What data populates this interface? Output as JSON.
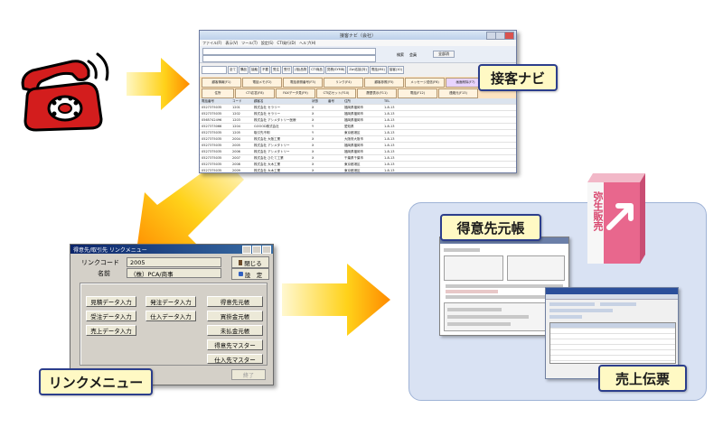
{
  "callouts": {
    "navi": "接客ナビ",
    "ledger": "得意先元帳",
    "link_menu": "リンクメニュー",
    "sales_slip": "売上伝票"
  },
  "product_box": {
    "label": "弥生販売"
  },
  "navi_window": {
    "title": "接客ナビ（会社）",
    "menu": [
      "ファイル(F)",
      "表示(V)",
      "ツール(T)",
      "設定(S)",
      "CTI発行(D)",
      "ヘルプ(H)"
    ],
    "options": [
      "検索",
      "会員"
    ],
    "search_button": "全部消",
    "tabs": [
      "全て",
      "購品",
      "接触",
      "不要",
      "受注",
      "受付",
      "(相)品物",
      "CTI商品",
      "見積(SYMB)",
      "Zwi応接(対)",
      "電話(M4)",
      "接客(10)"
    ],
    "buttons": [
      "顧客情報(F1)",
      "電話メモ(F2)",
      "電話参照番号(F3)",
      "リンク(F4)",
      "顧客参照(F5)",
      "メッセージ送信(F6)",
      "画面削除(F7)",
      "住所",
      "CTI応答(F8)",
      "FAXデータ見(F9)",
      "CTI応セット(F10)",
      "履歴表示(F11)",
      "電話(F12)",
      "連絡元(F13)",
      "画面ライン(F14)",
      "メッセージ",
      "アラーム"
    ],
    "grid_header": [
      "電話番号",
      "コード",
      "顧客名",
      "状態",
      "番号",
      "住所",
      "TEL"
    ],
    "grid_rows": [
      [
        "0527375035",
        "1201",
        "株式会社 セラリー",
        "X",
        "福岡県福岡市",
        "1-8-13"
      ],
      [
        "0527375035",
        "1202",
        "株式会社 セラリー",
        "X",
        "福岡県福岡市",
        "1-8-13"
      ],
      [
        "0565742496",
        "1203",
        "株式会社 アシメタトリー医療",
        "X",
        "福岡県福岡市",
        "1-8-13"
      ],
      [
        "0527373066",
        "1204",
        "GOOOD株式会社",
        "Y",
        "愛知県",
        "1-8-13"
      ],
      [
        "0527375035",
        "1205",
        "取引先不明",
        "Y",
        "東京都港区",
        "1-8-13"
      ],
      [
        "0527375035",
        "2004",
        "株式会社 大阪工業",
        "X",
        "大阪府大阪市",
        "1-8-13"
      ],
      [
        "0527375035",
        "2005",
        "株式会社 アシメタトリー",
        "X",
        "福岡県福岡市",
        "1-8-13"
      ],
      [
        "0527375035",
        "2006",
        "株式会社 アシメタトリー",
        "X",
        "福岡県福岡市",
        "1-8-13"
      ],
      [
        "0527375035",
        "2007",
        "株式会社 ひたて工業",
        "X",
        "千葉県千葉市",
        "1-8-13"
      ],
      [
        "0527375035",
        "2008",
        "株式会社 大木工業",
        "X",
        "東京都港区",
        "1-8-13"
      ],
      [
        "0527375035",
        "2009",
        "株式会社 大木工業",
        "X",
        "東京都港区",
        "1-8-13"
      ]
    ]
  },
  "link_menu_window": {
    "title": "得意先/取引先 リンクメニュー",
    "link_code_label": "リンクコード",
    "link_code_value": "2005",
    "name_label": "名前",
    "name_value": "（株）PCA/商事",
    "close_button": "閉じる",
    "settings_button": "設　定",
    "menu_buttons": [
      "見積データ入力",
      "発注データ入力",
      "得意先元帳",
      "受注データ入力",
      "仕入データ入力",
      "買掛金元帳",
      "売上データ入力",
      "未払金元帳",
      "得意先マスター",
      "仕入先マスター"
    ],
    "end_button": "終了"
  }
}
